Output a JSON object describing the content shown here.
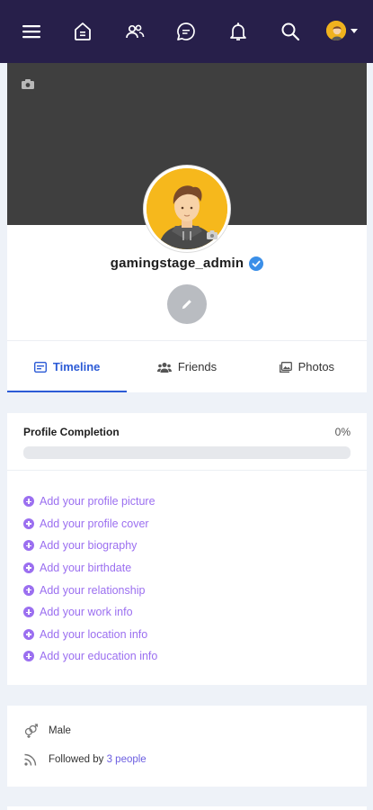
{
  "nav": {
    "icons": [
      "menu-icon",
      "home-icon",
      "friends-icon",
      "chat-icon",
      "bell-icon",
      "search-icon",
      "avatar"
    ]
  },
  "profile": {
    "username": "gamingstage_admin",
    "verified": true
  },
  "tabs": [
    {
      "label": "Timeline",
      "icon": "timeline-icon",
      "active": true
    },
    {
      "label": "Friends",
      "icon": "friends-icon",
      "active": false
    },
    {
      "label": "Photos",
      "icon": "photos-icon",
      "active": false
    }
  ],
  "completion": {
    "title": "Profile Completion",
    "percent_label": "0%",
    "progress": 0,
    "items": [
      "Add your profile picture",
      "Add your profile cover",
      "Add your biography",
      "Add your birthdate",
      "Add your relationship",
      "Add your work info",
      "Add your location info",
      "Add your education info"
    ]
  },
  "info": {
    "gender": "Male",
    "followed_prefix": "Followed by",
    "followed_link": "3 people"
  },
  "colors": {
    "nav_bg": "#271f4a",
    "accent_blue": "#2c5bd6",
    "accent_purple": "#9b6ff0",
    "verified": "#3b8fe8"
  }
}
